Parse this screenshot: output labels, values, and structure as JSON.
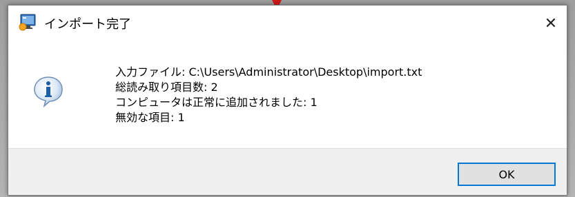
{
  "window": {
    "title": "インポート完了",
    "close_glyph": "✕"
  },
  "icons": {
    "app": "app-monitor-icon",
    "message": "information-icon",
    "close": "close-icon"
  },
  "message": {
    "lines": [
      "入力ファイル:  C:\\Users\\Administrator\\Desktop\\import.txt",
      "総読み取り項目数:  2",
      "コンピュータは正常に追加されました:  1",
      "無効な項目:  1"
    ]
  },
  "buttons": {
    "ok_label": "OK"
  },
  "colors": {
    "accent": "#0078d7",
    "annotation_arrow": "#d01a1a",
    "footer_bg": "#f0f0f0"
  }
}
